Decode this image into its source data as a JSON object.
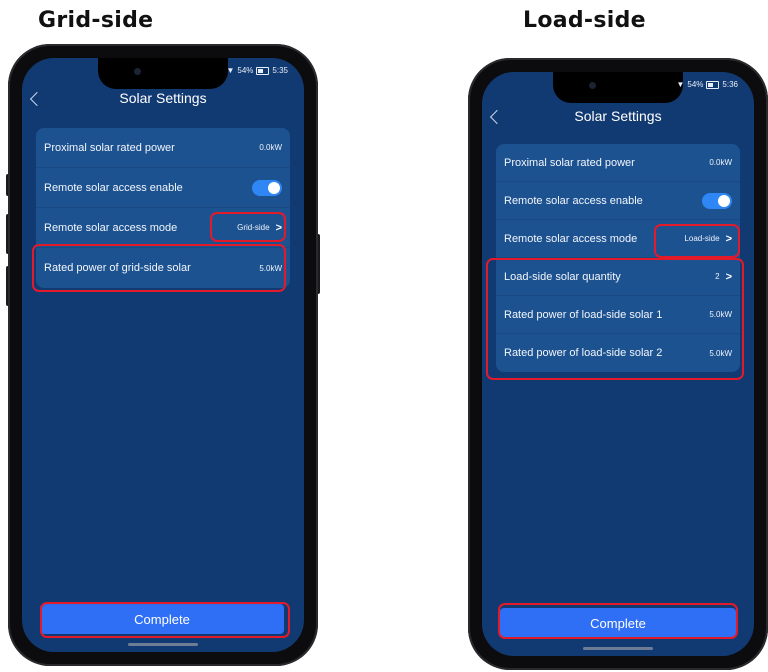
{
  "captions": {
    "left": "Grid-side",
    "right": "Load-side"
  },
  "left_phone": {
    "status": {
      "battery": "54%",
      "time": "5:35"
    },
    "title": "Solar Settings",
    "rows": [
      {
        "label": "Proximal solar rated power",
        "value": "0.0kW"
      },
      {
        "label": "Remote solar access enable",
        "toggle": "on"
      },
      {
        "label": "Remote solar access mode",
        "value": "Grid-side",
        "chevron": ">"
      },
      {
        "label": "Rated power of grid-side solar",
        "value": "5.0kW"
      }
    ],
    "complete_label": "Complete"
  },
  "right_phone": {
    "status": {
      "battery": "54%",
      "time": "5:36"
    },
    "title": "Solar Settings",
    "rows": [
      {
        "label": "Proximal solar rated power",
        "value": "0.0kW"
      },
      {
        "label": "Remote solar access enable",
        "toggle": "on"
      },
      {
        "label": "Remote solar access mode",
        "value": "Load-side",
        "chevron": ">"
      },
      {
        "label": "Load-side solar quantity",
        "value": "2",
        "chevron": ">"
      },
      {
        "label": "Rated power of load-side solar 1",
        "value": "5.0kW"
      },
      {
        "label": "Rated power of load-side solar 2",
        "value": "5.0kW"
      }
    ],
    "complete_label": "Complete"
  },
  "colors": {
    "screen_bg": "#123a72",
    "card_bg": "#1d5290",
    "accent": "#2f6ff5",
    "highlight": "#e21a2a"
  }
}
